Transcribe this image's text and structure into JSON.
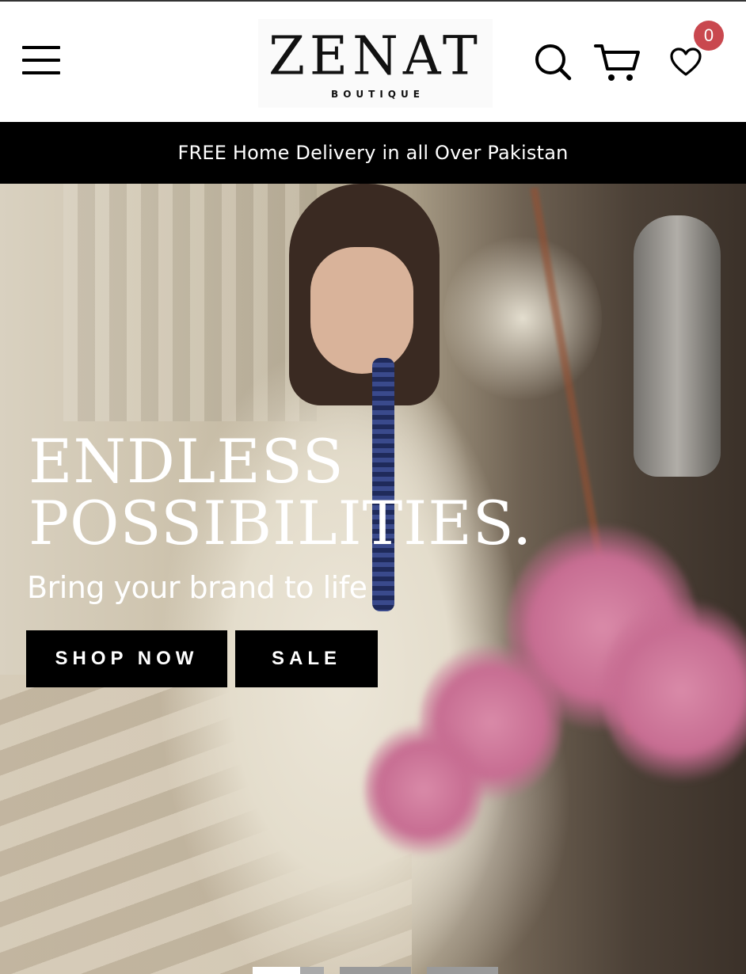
{
  "header": {
    "logo_title": "ZENAT",
    "logo_subtitle": "BOUTIQUE",
    "wishlist_count": "0"
  },
  "announcement": {
    "text": "FREE Home Delivery in all Over Pakistan"
  },
  "hero": {
    "title_line1": "ENDLESS",
    "title_line2": "POSSIBILITIES.",
    "subtitle": "Bring your brand to life",
    "buttons": {
      "shop_now": "SHOP NOW",
      "sale": "SALE"
    },
    "slides_total": 3,
    "active_slide": 1
  },
  "icons": {
    "menu": "hamburger-menu-icon",
    "search": "search-icon",
    "cart": "cart-icon",
    "wishlist": "heart-icon"
  },
  "colors": {
    "badge": "#c9484f",
    "announcement_bg": "#000000",
    "button_bg": "#000000"
  }
}
